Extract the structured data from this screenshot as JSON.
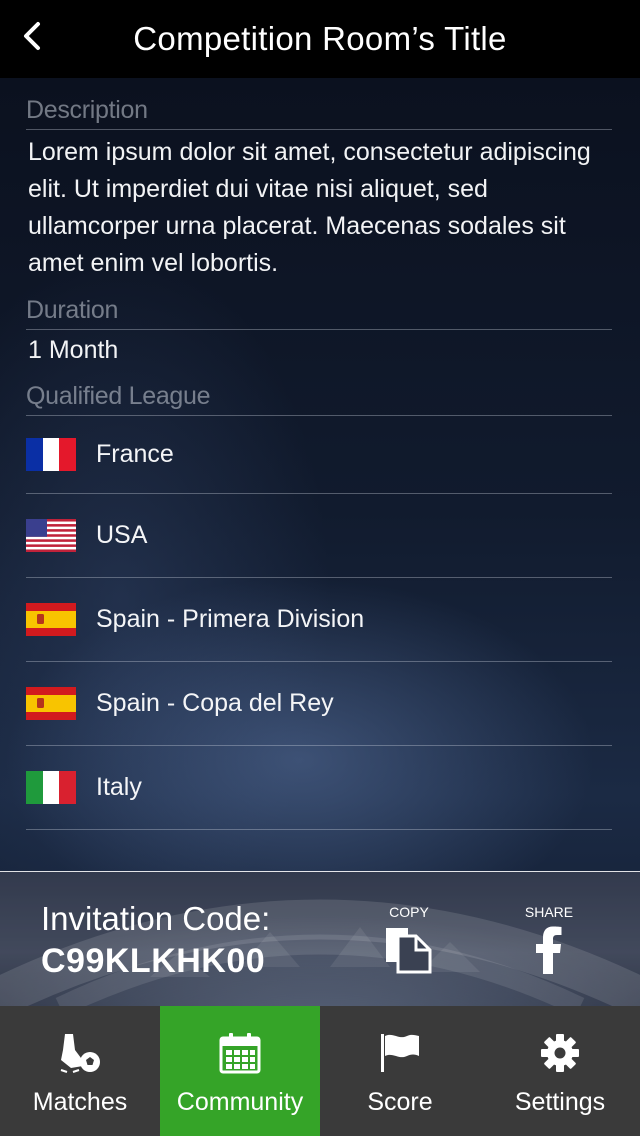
{
  "header": {
    "title": "Competition Room’s Title",
    "back_icon": "chevron-left-icon"
  },
  "description": {
    "label": "Description",
    "text": "Lorem ipsum dolor sit amet, consectetur adipiscing elit. Ut imperdiet dui vitae nisi aliquet, sed ullamcorper urna placerat. Maecenas sodales sit amet enim vel lobortis."
  },
  "duration": {
    "label": "Duration",
    "value": "1 Month"
  },
  "leagues": {
    "label": "Qualified League",
    "items": [
      {
        "name": "France",
        "flag": "france-flag-icon"
      },
      {
        "name": "USA",
        "flag": "usa-flag-icon"
      },
      {
        "name": "Spain - Primera Division",
        "flag": "spain-flag-icon"
      },
      {
        "name": "Spain - Copa del Rey",
        "flag": "spain-flag-icon"
      },
      {
        "name": "Italy",
        "flag": "italy-flag-icon"
      }
    ]
  },
  "invitation": {
    "label": "Invitation Code:",
    "code": "C99KLKHK00",
    "copy_label": "COPY",
    "share_label": "SHARE"
  },
  "tabbar": {
    "active_color": "#35a428",
    "tabs": [
      {
        "label": "Matches",
        "icon": "soccer-boot-ball-icon",
        "active": false
      },
      {
        "label": "Community",
        "icon": "calendar-icon",
        "active": true
      },
      {
        "label": "Score",
        "icon": "flag-icon",
        "active": false
      },
      {
        "label": "Settings",
        "icon": "gear-icon",
        "active": false
      }
    ]
  }
}
